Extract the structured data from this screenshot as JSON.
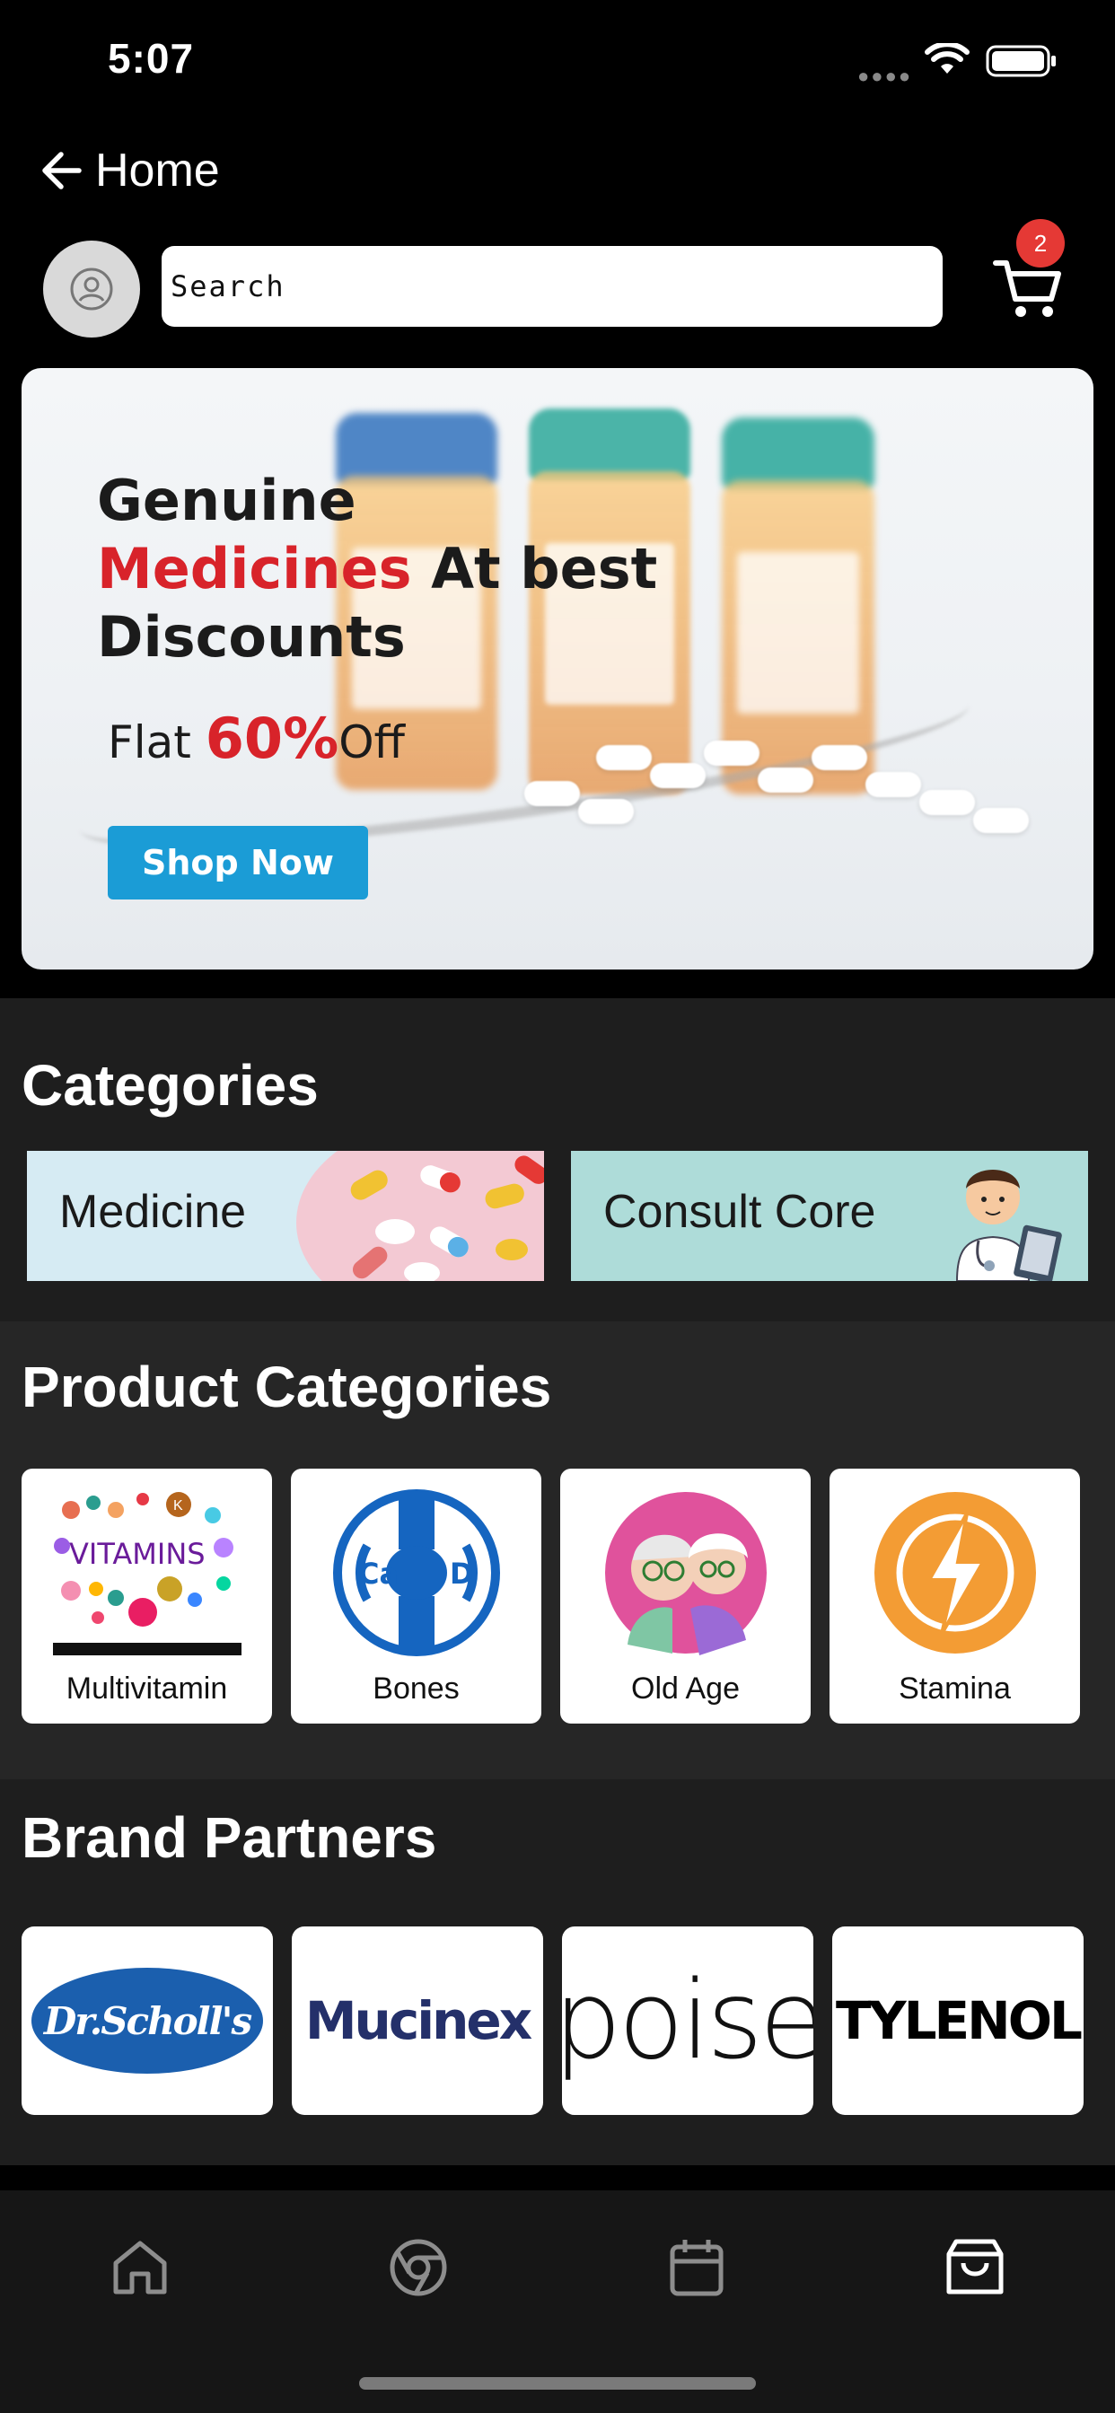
{
  "status_bar": {
    "time": "5:07"
  },
  "header": {
    "back_label": "Home",
    "search_placeholder": "Search",
    "cart_count": "2"
  },
  "banner": {
    "line1": "Genuine",
    "line2_red": "Medicines",
    "line2_rest": " At best",
    "line3": "Discounts",
    "flat_prefix": "Flat ",
    "flat_value": "60%",
    "flat_suffix": "Off",
    "cta": "Shop Now"
  },
  "categories": {
    "title": "Categories",
    "items": [
      {
        "label": "Medicine"
      },
      {
        "label": "Consult Core"
      }
    ]
  },
  "product_categories": {
    "title": "Product Categories",
    "items": [
      {
        "label": "Multivitamin",
        "icon": "vitamins-icon",
        "image_text": "VITAMINS"
      },
      {
        "label": "Bones",
        "icon": "bone-calcium-icon",
        "image_text_left": "Ca",
        "image_text_right": "D"
      },
      {
        "label": "Old Age",
        "icon": "elderly-couple-icon"
      },
      {
        "label": "Stamina",
        "icon": "lightning-icon"
      }
    ]
  },
  "brand_partners": {
    "title": "Brand Partners",
    "items": [
      {
        "name": "Dr.Scholl's",
        "logo_color": "#1b5fae"
      },
      {
        "name": "Mucinex",
        "logo_color": "#24306a"
      },
      {
        "name": "poise",
        "logo_color": "#111111"
      },
      {
        "name": "TYLENOL",
        "logo_color": "#000000"
      }
    ]
  },
  "tab_bar": {
    "items": [
      {
        "icon": "home-icon"
      },
      {
        "icon": "chrome-icon"
      },
      {
        "icon": "calendar-icon"
      },
      {
        "icon": "shopping-bag-icon",
        "active": true
      }
    ]
  },
  "colors": {
    "accent_red": "#d8232a",
    "cta_blue": "#1b9cd6",
    "badge_red": "#e53935"
  }
}
